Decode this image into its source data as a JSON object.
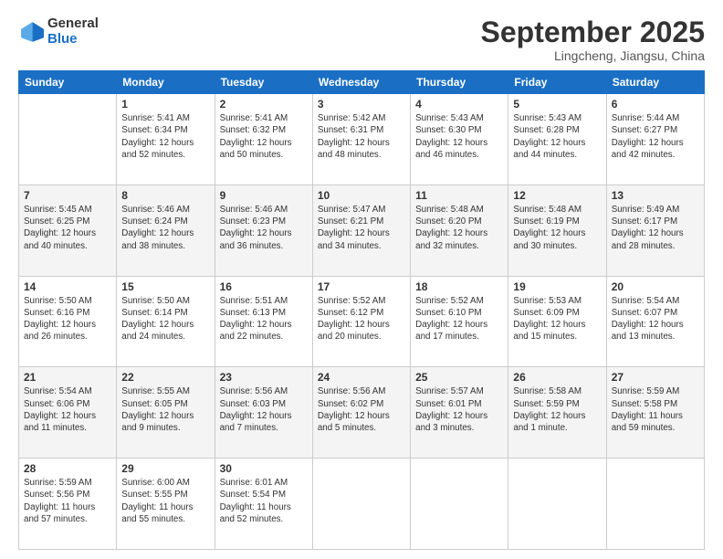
{
  "header": {
    "logo_general": "General",
    "logo_blue": "Blue",
    "month_title": "September 2025",
    "location": "Lingcheng, Jiangsu, China"
  },
  "weekdays": [
    "Sunday",
    "Monday",
    "Tuesday",
    "Wednesday",
    "Thursday",
    "Friday",
    "Saturday"
  ],
  "weeks": [
    [
      {
        "day": "",
        "info": ""
      },
      {
        "day": "1",
        "info": "Sunrise: 5:41 AM\nSunset: 6:34 PM\nDaylight: 12 hours\nand 52 minutes."
      },
      {
        "day": "2",
        "info": "Sunrise: 5:41 AM\nSunset: 6:32 PM\nDaylight: 12 hours\nand 50 minutes."
      },
      {
        "day": "3",
        "info": "Sunrise: 5:42 AM\nSunset: 6:31 PM\nDaylight: 12 hours\nand 48 minutes."
      },
      {
        "day": "4",
        "info": "Sunrise: 5:43 AM\nSunset: 6:30 PM\nDaylight: 12 hours\nand 46 minutes."
      },
      {
        "day": "5",
        "info": "Sunrise: 5:43 AM\nSunset: 6:28 PM\nDaylight: 12 hours\nand 44 minutes."
      },
      {
        "day": "6",
        "info": "Sunrise: 5:44 AM\nSunset: 6:27 PM\nDaylight: 12 hours\nand 42 minutes."
      }
    ],
    [
      {
        "day": "7",
        "info": "Sunrise: 5:45 AM\nSunset: 6:25 PM\nDaylight: 12 hours\nand 40 minutes."
      },
      {
        "day": "8",
        "info": "Sunrise: 5:46 AM\nSunset: 6:24 PM\nDaylight: 12 hours\nand 38 minutes."
      },
      {
        "day": "9",
        "info": "Sunrise: 5:46 AM\nSunset: 6:23 PM\nDaylight: 12 hours\nand 36 minutes."
      },
      {
        "day": "10",
        "info": "Sunrise: 5:47 AM\nSunset: 6:21 PM\nDaylight: 12 hours\nand 34 minutes."
      },
      {
        "day": "11",
        "info": "Sunrise: 5:48 AM\nSunset: 6:20 PM\nDaylight: 12 hours\nand 32 minutes."
      },
      {
        "day": "12",
        "info": "Sunrise: 5:48 AM\nSunset: 6:19 PM\nDaylight: 12 hours\nand 30 minutes."
      },
      {
        "day": "13",
        "info": "Sunrise: 5:49 AM\nSunset: 6:17 PM\nDaylight: 12 hours\nand 28 minutes."
      }
    ],
    [
      {
        "day": "14",
        "info": "Sunrise: 5:50 AM\nSunset: 6:16 PM\nDaylight: 12 hours\nand 26 minutes."
      },
      {
        "day": "15",
        "info": "Sunrise: 5:50 AM\nSunset: 6:14 PM\nDaylight: 12 hours\nand 24 minutes."
      },
      {
        "day": "16",
        "info": "Sunrise: 5:51 AM\nSunset: 6:13 PM\nDaylight: 12 hours\nand 22 minutes."
      },
      {
        "day": "17",
        "info": "Sunrise: 5:52 AM\nSunset: 6:12 PM\nDaylight: 12 hours\nand 20 minutes."
      },
      {
        "day": "18",
        "info": "Sunrise: 5:52 AM\nSunset: 6:10 PM\nDaylight: 12 hours\nand 17 minutes."
      },
      {
        "day": "19",
        "info": "Sunrise: 5:53 AM\nSunset: 6:09 PM\nDaylight: 12 hours\nand 15 minutes."
      },
      {
        "day": "20",
        "info": "Sunrise: 5:54 AM\nSunset: 6:07 PM\nDaylight: 12 hours\nand 13 minutes."
      }
    ],
    [
      {
        "day": "21",
        "info": "Sunrise: 5:54 AM\nSunset: 6:06 PM\nDaylight: 12 hours\nand 11 minutes."
      },
      {
        "day": "22",
        "info": "Sunrise: 5:55 AM\nSunset: 6:05 PM\nDaylight: 12 hours\nand 9 minutes."
      },
      {
        "day": "23",
        "info": "Sunrise: 5:56 AM\nSunset: 6:03 PM\nDaylight: 12 hours\nand 7 minutes."
      },
      {
        "day": "24",
        "info": "Sunrise: 5:56 AM\nSunset: 6:02 PM\nDaylight: 12 hours\nand 5 minutes."
      },
      {
        "day": "25",
        "info": "Sunrise: 5:57 AM\nSunset: 6:01 PM\nDaylight: 12 hours\nand 3 minutes."
      },
      {
        "day": "26",
        "info": "Sunrise: 5:58 AM\nSunset: 5:59 PM\nDaylight: 12 hours\nand 1 minute."
      },
      {
        "day": "27",
        "info": "Sunrise: 5:59 AM\nSunset: 5:58 PM\nDaylight: 11 hours\nand 59 minutes."
      }
    ],
    [
      {
        "day": "28",
        "info": "Sunrise: 5:59 AM\nSunset: 5:56 PM\nDaylight: 11 hours\nand 57 minutes."
      },
      {
        "day": "29",
        "info": "Sunrise: 6:00 AM\nSunset: 5:55 PM\nDaylight: 11 hours\nand 55 minutes."
      },
      {
        "day": "30",
        "info": "Sunrise: 6:01 AM\nSunset: 5:54 PM\nDaylight: 11 hours\nand 52 minutes."
      },
      {
        "day": "",
        "info": ""
      },
      {
        "day": "",
        "info": ""
      },
      {
        "day": "",
        "info": ""
      },
      {
        "day": "",
        "info": ""
      }
    ]
  ]
}
